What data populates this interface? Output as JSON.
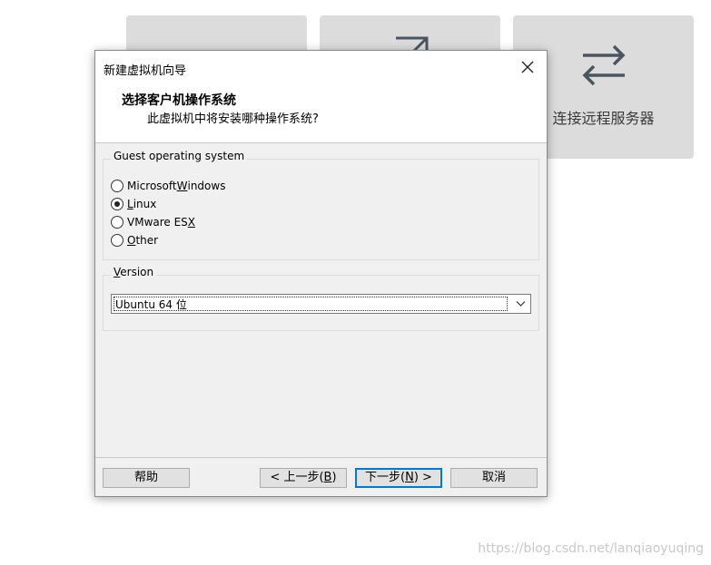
{
  "background_cards": [
    {
      "label": "",
      "icon": "globe-icon"
    },
    {
      "label": "",
      "icon": "open-external-icon"
    },
    {
      "label": "连接远程服务器",
      "icon": "swap-arrows-icon"
    }
  ],
  "dialog": {
    "title": "新建虚拟机向导",
    "header_title": "选择客户机操作系统",
    "header_subtitle": "此虚拟机中将安装哪种操作系统?",
    "guest_os_group": {
      "label": "Guest operating system",
      "options": [
        {
          "before": "Microsoft ",
          "mnemonic": "W",
          "after": "indows",
          "checked": false
        },
        {
          "before": "",
          "mnemonic": "L",
          "after": "inux",
          "checked": true
        },
        {
          "before": "VMware ES",
          "mnemonic": "X",
          "after": "",
          "checked": false
        },
        {
          "before": "",
          "mnemonic": "O",
          "after": "ther",
          "checked": false
        }
      ]
    },
    "version_group": {
      "label_mnemonic": "V",
      "label_rest": "ersion",
      "selected": "Ubuntu 64 位"
    },
    "buttons": {
      "help": "帮助",
      "back_before": "< 上一步(",
      "back_mnemonic": "B",
      "back_after": ")",
      "next_before": "下一步(",
      "next_mnemonic": "N",
      "next_after": ") >",
      "cancel": "取消"
    }
  },
  "watermark": "https://blog.csdn.net/lanqiaoyuqing",
  "colors": {
    "accent": "#0078d7",
    "card_bg": "#dcdcdc",
    "dialog_bg": "#f0f0f0"
  }
}
